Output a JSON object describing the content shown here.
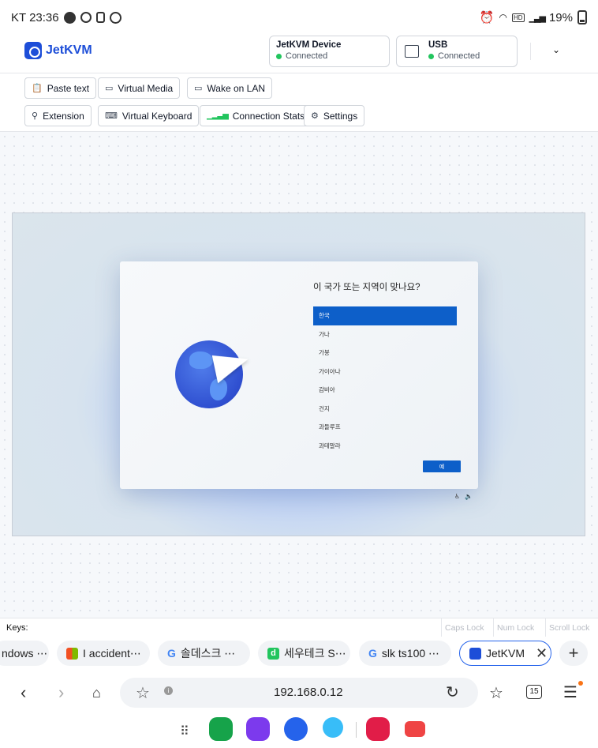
{
  "status_bar": {
    "carrier_time": "KT 23:36",
    "battery": "19%",
    "hd_label": "HD"
  },
  "app": {
    "name": "JetKVM",
    "device_card": {
      "title": "JetKVM Device",
      "status": "Connected"
    },
    "usb_card": {
      "title": "USB",
      "status": "Connected"
    },
    "status_color": "#22c55e",
    "brand_color": "#1d4ed8"
  },
  "toolbar": {
    "paste_text": "Paste text",
    "virtual_media": "Virtual Media",
    "wake_on_lan": "Wake on LAN",
    "extension": "Extension",
    "virtual_keyboard": "Virtual Keyboard",
    "connection_stats": "Connection Stats",
    "settings": "Settings"
  },
  "remote_screen": {
    "dialog_title": "이 국가 또는 지역이 맞나요?",
    "regions": [
      "한국",
      "가나",
      "가봉",
      "가이아나",
      "감비아",
      "건지",
      "과들루프",
      "과테말라"
    ],
    "selected_index": 0,
    "ok_button": "예",
    "accent_color": "#0d5fc9"
  },
  "keys_bar": {
    "label": "Keys:",
    "caps_lock": "Caps Lock",
    "num_lock": "Num Lock",
    "scroll_lock": "Scroll Lock"
  },
  "browser": {
    "tabs": [
      {
        "label": "ndows ⋯",
        "favicon": "none"
      },
      {
        "label": "I accident⋯",
        "favicon": "microsoft-icon"
      },
      {
        "label": "솔데스크 ⋯",
        "favicon": "google-icon"
      },
      {
        "label": "세우테크 S⋯",
        "favicon": "d-icon"
      },
      {
        "label": "slk ts100 ⋯",
        "favicon": "google-icon"
      },
      {
        "label": "JetKVM",
        "favicon": "jetkvm-icon"
      }
    ],
    "url": "192.168.0.12",
    "tab_count": "15"
  }
}
